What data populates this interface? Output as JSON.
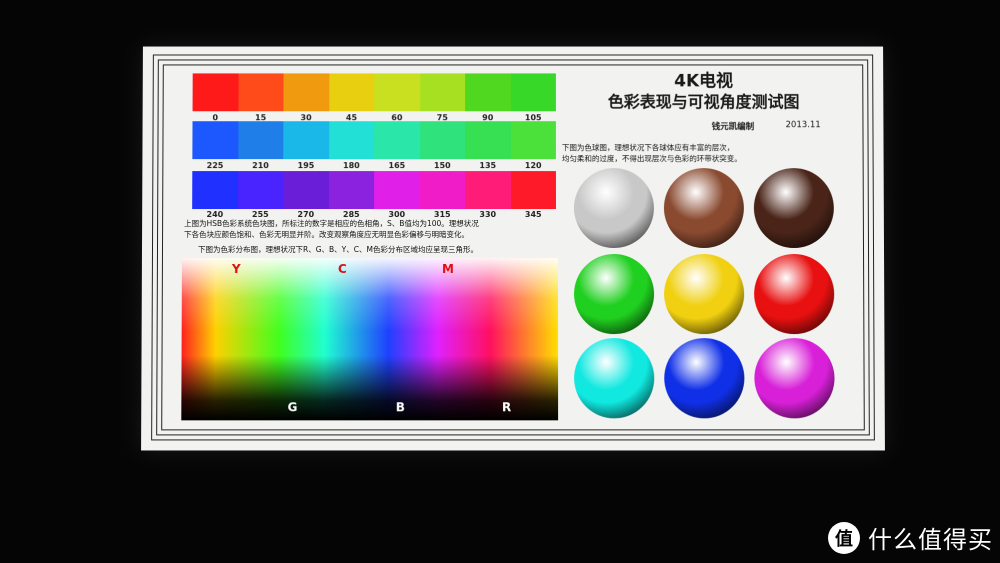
{
  "chart": {
    "title_line1": "4K电视",
    "title_line2": "色彩表现与可视角度测试图",
    "author": "钱元凯编制",
    "date": "2013.11",
    "row1_labels": [
      "0",
      "15",
      "30",
      "45",
      "60",
      "75",
      "90",
      "105"
    ],
    "row2_labels": [
      "225",
      "210",
      "195",
      "180",
      "165",
      "150",
      "135",
      "120"
    ],
    "row3_labels": [
      "240",
      "255",
      "270",
      "285",
      "300",
      "315",
      "330",
      "345"
    ],
    "row1_colors": [
      "#ff1a1a",
      "#ff4a1a",
      "#f09a10",
      "#e8d010",
      "#c8e020",
      "#a6e020",
      "#50d820",
      "#38d828"
    ],
    "row2_colors": [
      "#1d58ff",
      "#1f7ee8",
      "#19b8e8",
      "#23e0d6",
      "#2ae6a8",
      "#2fe27c",
      "#36e052",
      "#4ce03a"
    ],
    "row3_colors": [
      "#2030ff",
      "#4a24ff",
      "#6a1ed8",
      "#8a22e0",
      "#e020e8",
      "#f01cc8",
      "#ff1c78",
      "#ff1a2a"
    ],
    "hsb_note_line1": "上图为HSB色彩系统色块图，所标注的数字是相应的色相角，S、B值均为100。理想状况",
    "hsb_note_line2": "下各色块应颜色饱和、色彩无明显并阶。改变观察角度应无明显色彩偏移与明暗变化。",
    "gamut_note": "下图为色彩分布图，理想状况下R、G、B、Y、C、M色彩分布区域均应呈现三角形。",
    "sphere_note_line1": "下图为色球图，理想状况下各球体应有丰富的层次，",
    "sphere_note_line2": "均匀柔和的过度，不得出现层次与色彩的环带状突变。",
    "gamut_top": [
      "Y",
      "C",
      "M"
    ],
    "gamut_bottom": [
      "G",
      "B",
      "R"
    ],
    "sphere_colors": [
      "#c8c8c8",
      "#8a4a30",
      "#4a2418",
      "#20d020",
      "#f0d010",
      "#e81010",
      "#10e8e0",
      "#1030e8",
      "#d820d8"
    ],
    "watermark_text": "什么值得买",
    "watermark_badge": "值"
  }
}
